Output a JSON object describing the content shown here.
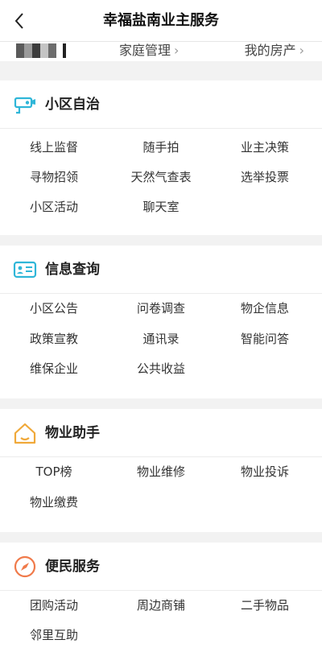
{
  "header": {
    "title": "幸福盐南业主服务"
  },
  "user_bar": {
    "home_manage": "家庭管理",
    "my_house": "我的房产"
  },
  "sections": [
    {
      "title": "小区自治",
      "icon": "camera-icon",
      "color": "#2fb6d8",
      "items": [
        "线上监督",
        "随手拍",
        "业主决策",
        "寻物招领",
        "天然气查表",
        "选举投票",
        "小区活动",
        "聊天室"
      ]
    },
    {
      "title": "信息查询",
      "icon": "id-card-icon",
      "color": "#2fb6d8",
      "items": [
        "小区公告",
        "问卷调查",
        "物企信息",
        "政策宣教",
        "通讯录",
        "智能问答",
        "维保企业",
        "公共收益"
      ]
    },
    {
      "title": "物业助手",
      "icon": "house-icon",
      "color": "#f0a93a",
      "items": [
        "TOP榜",
        "物业维修",
        "物业投诉",
        "物业缴费"
      ]
    },
    {
      "title": "便民服务",
      "icon": "compass-icon",
      "color": "#f07a4a",
      "items": [
        "团购活动",
        "周边商铺",
        "二手物品",
        "邻里互助"
      ]
    }
  ]
}
